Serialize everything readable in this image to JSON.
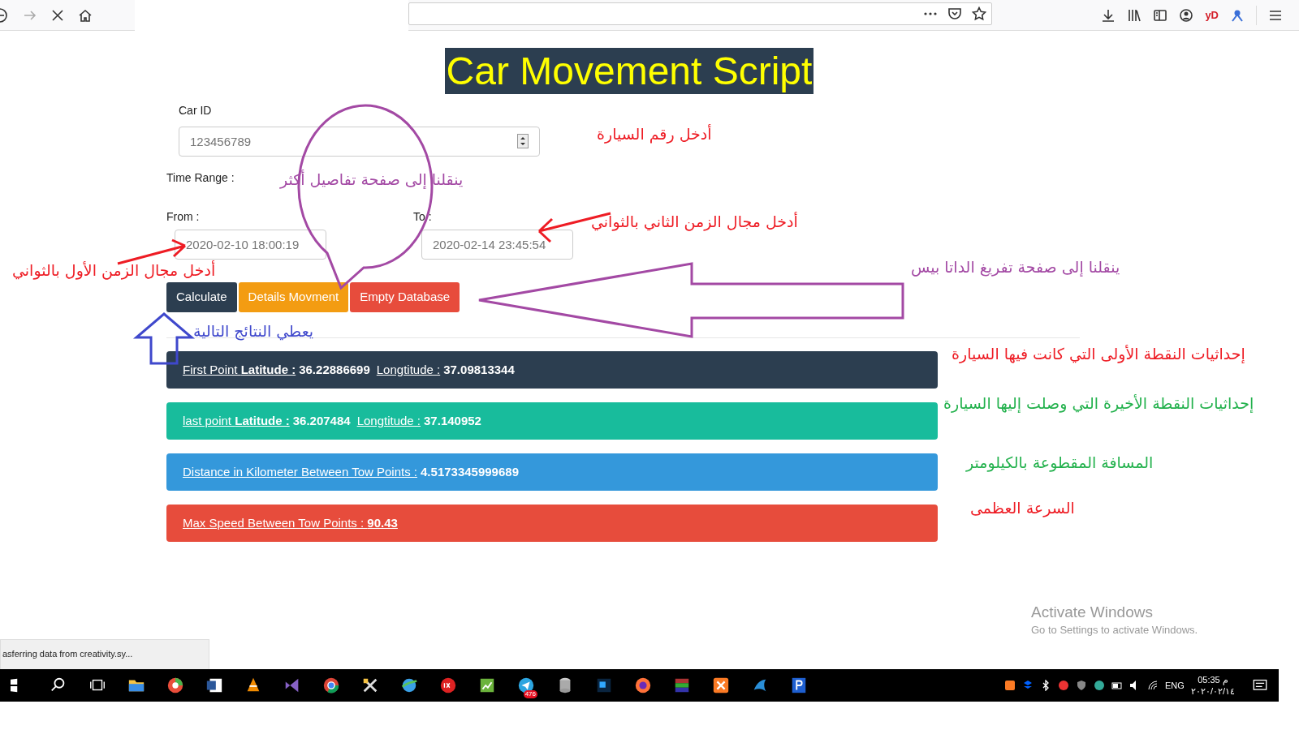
{
  "browser": {
    "extension_label": "yD"
  },
  "page": {
    "title": "Car Movement Script",
    "car_id": {
      "label": "Car ID",
      "placeholder": "123456789"
    },
    "time_range_label": "Time Range :",
    "from": {
      "label": "From :",
      "placeholder": "2020-02-10 18:00:19"
    },
    "to": {
      "label": "To :",
      "placeholder": "2020-02-14 23:45:54"
    },
    "buttons": [
      {
        "label": "Calculate",
        "color": "#2c3e50"
      },
      {
        "label": "Details Movment",
        "color": "#f39c12"
      },
      {
        "label": "Empty Database",
        "color": "#e74c3c"
      }
    ],
    "results": [
      {
        "color": "#2c3e50",
        "items": [
          {
            "label": "First Point **Latitude :**",
            "value": "36.22886699"
          },
          {
            "label": "Longtitude :",
            "value": "37.09813344"
          }
        ]
      },
      {
        "color": "#18bc9c",
        "items": [
          {
            "label": "last point **Latitude :**",
            "value": "36.207484"
          },
          {
            "label": "Longtitude :",
            "value": "37.140952"
          }
        ]
      },
      {
        "color": "#3498db",
        "items": [
          {
            "label": "Distance in Kilometer Between Tow Points :",
            "value": "4.5173345999689"
          }
        ]
      },
      {
        "color": "#e74c3c",
        "items": [
          {
            "label": "Max Speed Between Tow Points : **90.43**"
          }
        ]
      }
    ]
  },
  "annotations": [
    {
      "text": "أدخل رقم السيارة",
      "color": "#ee1c24"
    },
    {
      "text": "ينقلنا إلى صفحة تفاصيل أكثر",
      "color": "#a349a4"
    },
    {
      "text": "أدخل مجال الزمن الثاني بالثواني",
      "color": "#ee1c24"
    },
    {
      "text": "ينقلنا إلى صفحة تفريغ الداتا بيس",
      "color": "#a349a4"
    },
    {
      "text": "أدخل مجال الزمن الأول بالثواني",
      "color": "#ee1c24"
    },
    {
      "text": "يعطي النتائج التالية",
      "color": "#3f48cc"
    },
    {
      "text": "إحداثيات النقطة الأولى التي كانت فيها السيارة",
      "color": "#ee1c24"
    },
    {
      "text": "إحداثيات النقطة الأخيرة التي وصلت إليها السيارة",
      "color": "#22b14c"
    },
    {
      "text": "المسافة المقطوعة بالكيلومتر",
      "color": "#22b14c"
    },
    {
      "text": "السرعة العظمى",
      "color": "#ee1c24"
    }
  ],
  "status_text": "asferring data from creativity.sy...",
  "activation": {
    "title": "Activate Windows",
    "subtitle": "Go to Settings to activate Windows."
  },
  "taskbar": {
    "telegram_badge": "476",
    "language": "ENG",
    "time": "05:35 م",
    "date": "٢٠٢٠/٠٢/١٤"
  }
}
